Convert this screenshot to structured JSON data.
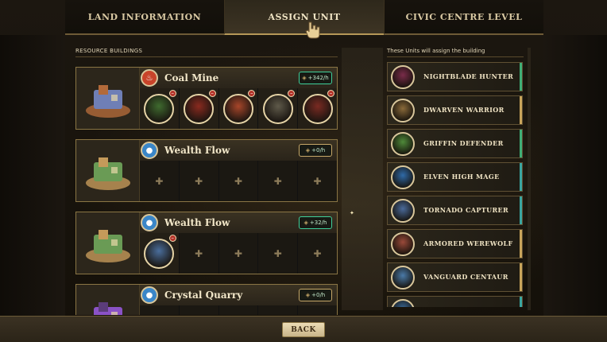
{
  "tabs": [
    {
      "label": "LAND INFORMATION",
      "active": false
    },
    {
      "label": "ASSIGN UNIT",
      "active": true
    },
    {
      "label": "CIVIC CENTRE LEVEL",
      "active": false
    }
  ],
  "left_panel": {
    "title": "RESOURCE BUILDINGS",
    "rows": [
      {
        "name": "Coal Mine",
        "icon": "fire-icon",
        "rate": "+342/h",
        "slots": [
          "unit",
          "unit",
          "unit",
          "unit",
          "unit"
        ]
      },
      {
        "name": "Wealth Flow",
        "icon": "water-drop-icon",
        "rate": "+0/h",
        "slots": [
          "empty",
          "empty",
          "empty",
          "empty",
          "empty"
        ]
      },
      {
        "name": "Wealth Flow",
        "icon": "water-drop-icon",
        "rate": "+32/h",
        "slots": [
          "unit",
          "empty",
          "empty",
          "empty",
          "empty"
        ]
      },
      {
        "name": "Crystal Quarry",
        "icon": "water-drop-icon",
        "rate": "+0/h",
        "slots": [
          "empty",
          "empty",
          "empty",
          "empty",
          "empty"
        ]
      }
    ]
  },
  "right_panel": {
    "title": "These Units will assign the building",
    "units": [
      {
        "name": "NIGHTBLADE HUNTER",
        "accent": "#3fae76"
      },
      {
        "name": "DWARVEN WARRIOR",
        "accent": "#c9a55b"
      },
      {
        "name": "GRIFFIN DEFENDER",
        "accent": "#3fae76"
      },
      {
        "name": "ELVEN HIGH MAGE",
        "accent": "#3aa6a0"
      },
      {
        "name": "TORNADO CAPTURER",
        "accent": "#3aa6a0"
      },
      {
        "name": "ARMORED WEREWOLF",
        "accent": "#c9a55b"
      },
      {
        "name": "VANGUARD CENTAUR",
        "accent": "#c9a55b"
      },
      {
        "name": "",
        "accent": "#3aa6a0"
      }
    ]
  },
  "back_label": "BACK",
  "colors": {
    "gold": "#c7a868",
    "green": "#3fd09a",
    "red": "#b3342a"
  }
}
